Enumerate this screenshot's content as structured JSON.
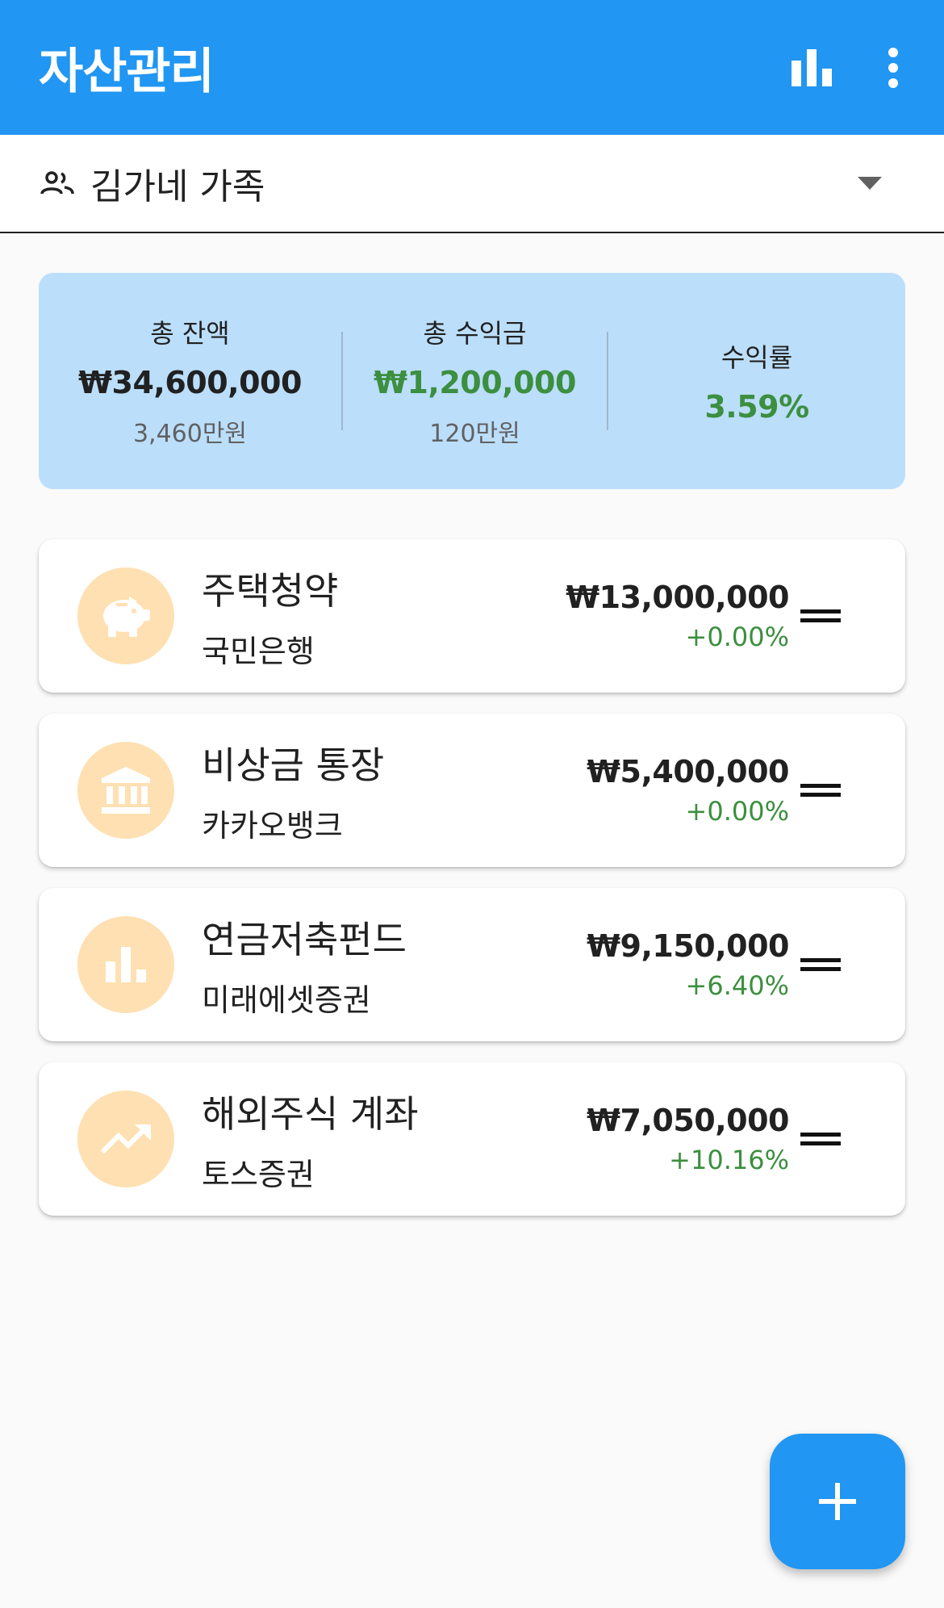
{
  "app_bar": {
    "title": "자산관리",
    "actions": [
      {
        "icon": "bar-chart-icon"
      },
      {
        "icon": "more-vert-icon"
      }
    ],
    "color": "#2196f3"
  },
  "group_selector": {
    "icon": "people-icon",
    "label": "김가네 가족"
  },
  "summary": {
    "total_balance": {
      "label": "총 잔액",
      "value": "₩34,600,000",
      "sub": "3,460만원"
    },
    "total_profit": {
      "label": "총 수익금",
      "value": "₩1,200,000",
      "sub": "120만원"
    },
    "return_rate": {
      "label": "수익률",
      "value": "3.59%"
    }
  },
  "accounts": [
    {
      "icon": "piggy-bank-icon",
      "name": "주택청약",
      "bank": "국민은행",
      "amount": "₩13,000,000",
      "rate": "+0.00%"
    },
    {
      "icon": "bank-icon",
      "name": "비상금 통장",
      "bank": "카카오뱅크",
      "amount": "₩5,400,000",
      "rate": "+0.00%"
    },
    {
      "icon": "bar-chart-icon",
      "name": "연금저축펀드",
      "bank": "미래에셋증권",
      "amount": "₩9,150,000",
      "rate": "+6.40%"
    },
    {
      "icon": "trending-up-icon",
      "name": "해외주식 계좌",
      "bank": "토스증권",
      "amount": "₩7,050,000",
      "rate": "+10.16%"
    }
  ],
  "fab": {
    "icon": "plus-icon"
  },
  "colors": {
    "primary": "#2196f3",
    "positive": "#3c8f3f",
    "summary_bg": "#bbdefb",
    "icon_bg": "#ffe0b2"
  }
}
